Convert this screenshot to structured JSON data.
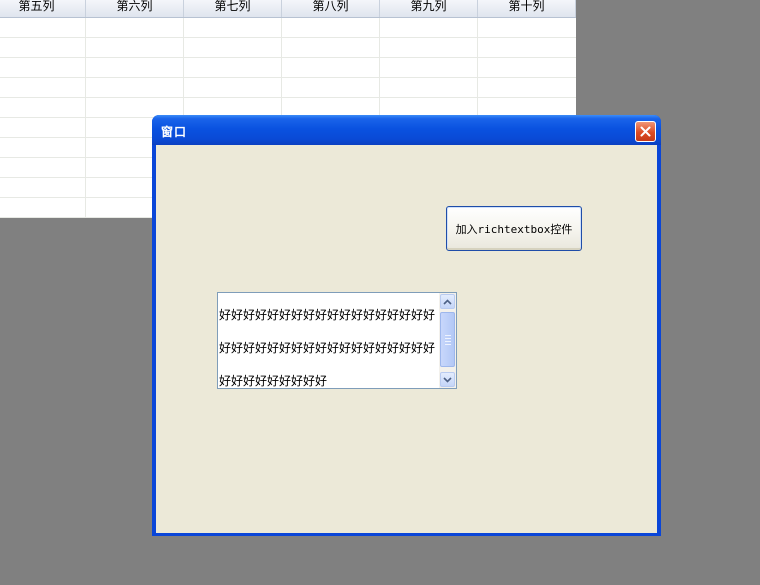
{
  "grid": {
    "columns": [
      "第五列",
      "第六列",
      "第七列",
      "第八列",
      "第九列",
      "第十列"
    ]
  },
  "window": {
    "title": "窗口",
    "button_label": "加入richtextbox控件",
    "richtextbox": {
      "lines": [
        "好好好好好好好好好好好好好好好好好好",
        "好好好好好好好好好好好好好好好好好好",
        "好好好好好好好好好"
      ]
    }
  },
  "colors": {
    "desktop": "#808080",
    "title_bar": "#0a52e0",
    "client": "#ece9d8",
    "close_button": "#dd4c24"
  }
}
